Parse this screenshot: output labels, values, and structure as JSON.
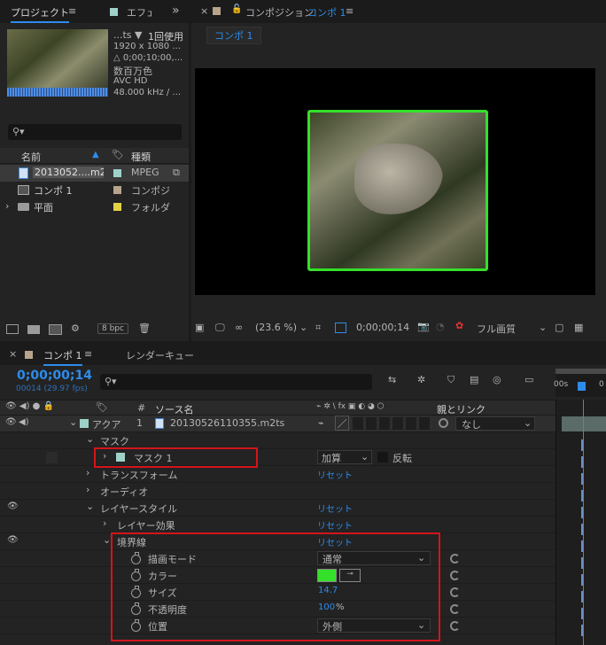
{
  "project": {
    "tab_label": "プロジェクト",
    "tab_menu": "≡",
    "effects_tab": "エフェ",
    "more": "»",
    "thumb_info": {
      "name": "...ts ▼",
      "usage": "1回使用",
      "size": "1920 x 1080 ...",
      "duration": "△ 0;00;10;00,...",
      "colors": "数百万色",
      "codec": "AVC HD",
      "audio": "48.000 kHz / ..."
    },
    "columns": {
      "name": "名前",
      "type": "種類"
    },
    "items": [
      {
        "name": "2013052....m2ts",
        "type": "MPEG",
        "color": "#9ed1c8"
      },
      {
        "name": "コンポ 1",
        "type": "コンポジ",
        "color": "#b8a48c"
      },
      {
        "name": "平面",
        "type": "フォルダ",
        "color": "#e3d145"
      }
    ],
    "bpc": "8 bpc"
  },
  "comp_viewer": {
    "title_prefix": "コンポジション",
    "title_name": "コンポ 1",
    "menu": "≡",
    "tab": "コンポ 1",
    "zoom": "(23.6 %)",
    "timecode": "0;00;00;14",
    "quality": "フル画質"
  },
  "timeline": {
    "tab": "コンポ 1",
    "render_tab": "レンダーキュー",
    "timecode": "0;00;00;14",
    "frame_info": "00014 (29.97 fps)",
    "header": {
      "hash": "#",
      "source": "ソース名",
      "switches": "⌁ ✲ \\ fx ▣ ◐ ◕ ⬡",
      "parent": "親とリンク"
    },
    "ruler": {
      "start": "00s",
      "tick": "0"
    },
    "layer": {
      "name": "アクア",
      "number": "1",
      "source": "20130526110355.m2ts",
      "parent": "なし",
      "color": "#9ed1c8"
    },
    "rows": {
      "mask_group": "マスク",
      "mask1": "マスク 1",
      "mask_mode": "加算",
      "invert": "反転",
      "transform": "トランスフォーム",
      "audio": "オーディオ",
      "layer_styles": "レイヤースタイル",
      "layer_effects": "レイヤー効果",
      "stroke": "境界線",
      "blend_mode": "描画モード",
      "blend_value": "通常",
      "color": "カラー",
      "size": "サイズ",
      "size_value": "14.7",
      "opacity": "不透明度",
      "opacity_value": "100",
      "opacity_unit": "%",
      "position": "位置",
      "position_value": "外側",
      "reset": "リセット"
    },
    "stroke_color": "#35e02a"
  }
}
